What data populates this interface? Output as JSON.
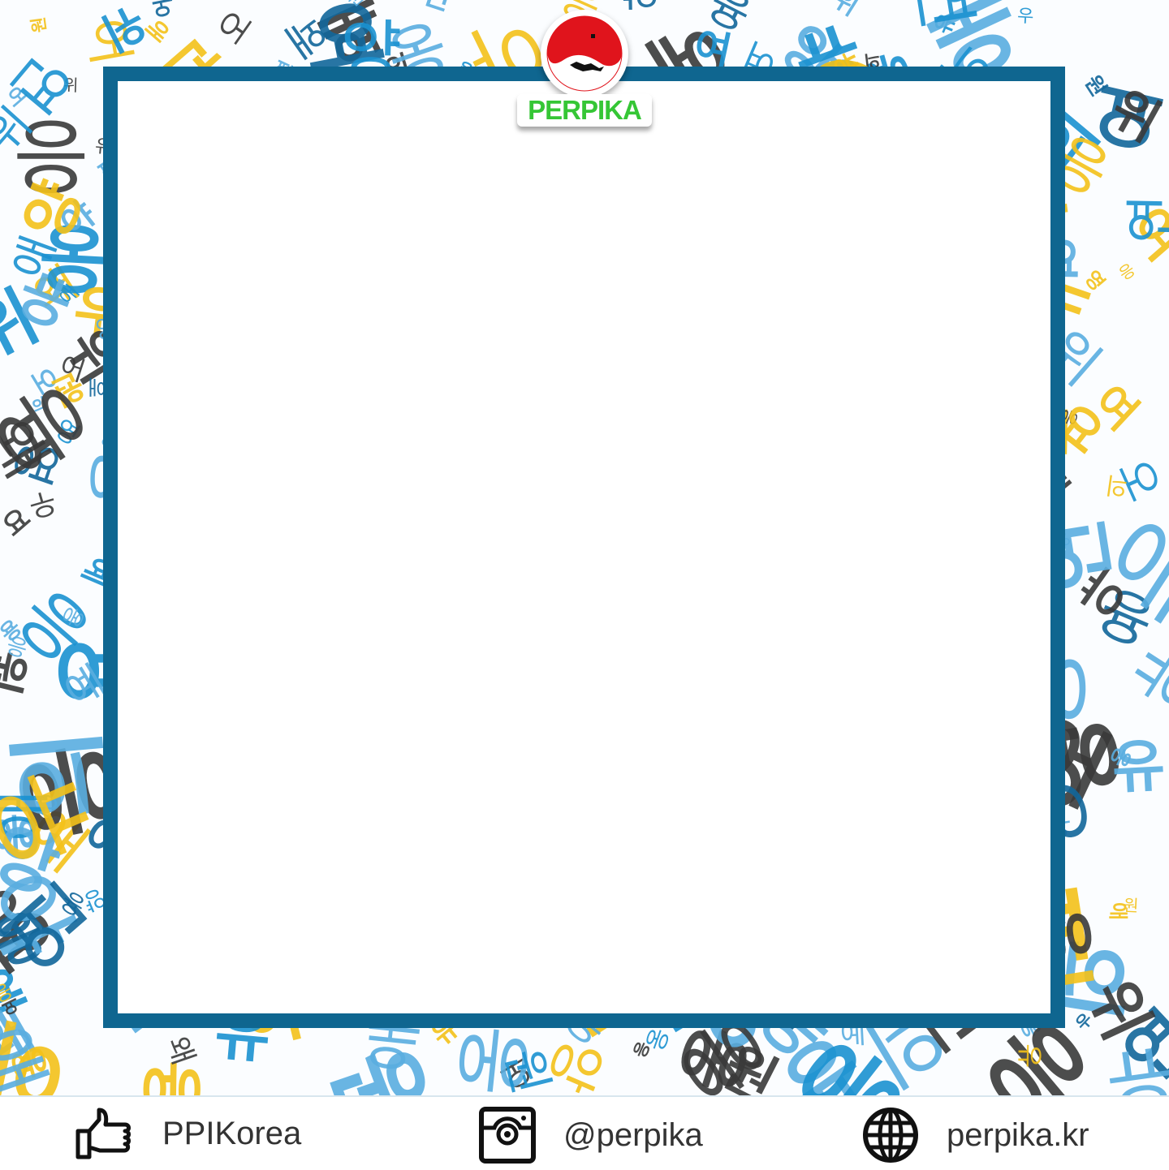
{
  "logo": {
    "text": "PERPIKA",
    "colors": {
      "red": "#e0141c",
      "green": "#35c635"
    }
  },
  "frame": {
    "border_color": "#0f6690"
  },
  "pattern": {
    "glyphs": [
      "영",
      "우",
      "여",
      "유",
      "어",
      "용",
      "양",
      "요",
      "연",
      "앙",
      "왜",
      "위",
      "원",
      "오",
      "애",
      "야",
      "응",
      "의",
      "예",
      "웅"
    ],
    "colors": [
      "#1b92d1",
      "#12679b",
      "#f4c21a",
      "#3a3a3a",
      "#5aaee0"
    ]
  },
  "footer": {
    "items": [
      {
        "icon": "thumbs-up-icon",
        "label": "PPIKorea"
      },
      {
        "icon": "instagram-icon",
        "label": "@perpika"
      },
      {
        "icon": "globe-icon",
        "label": "perpika.kr"
      }
    ]
  }
}
